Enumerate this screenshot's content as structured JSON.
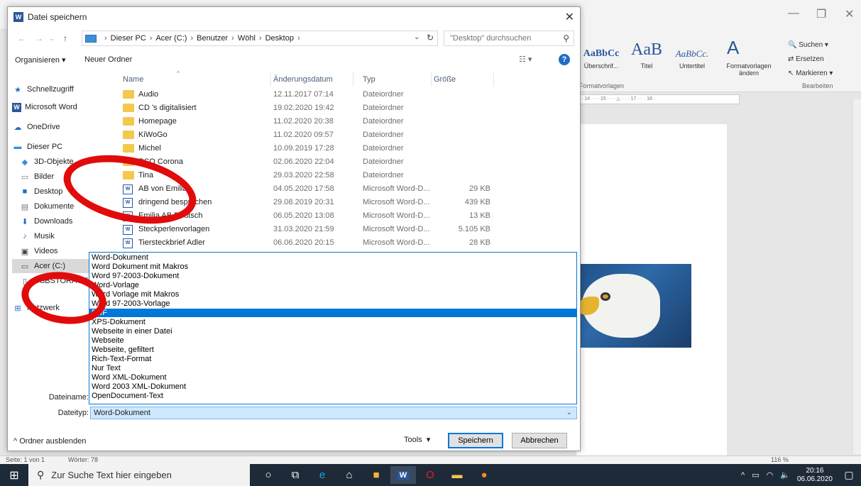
{
  "word": {
    "window_controls": [
      "—",
      "❐",
      "✕"
    ],
    "styles": [
      {
        "sample": "AaBbCc",
        "name": "Überschrif..."
      },
      {
        "sample": "AaB",
        "name": "Titel"
      },
      {
        "sample": "AaBbCc.",
        "name": "Untertitel"
      }
    ],
    "formatvorlagen_label": "Formatvorlagen",
    "formatvorlagen_aendern": "Formatvorlagen ändern",
    "bearbeiten_label": "Bearbeiten",
    "suchen": "Suchen",
    "ersetzen": "Ersetzen",
    "markieren": "Markieren",
    "ruler_text": "· 14 · · · 15 · · · △ · · · 17 · · · 18 ·",
    "status_page": "Seite: 1 von 1",
    "status_words": "Wörter: 78",
    "status_zoom": "116 %"
  },
  "dialog": {
    "title": "Datei speichern",
    "address": [
      "Dieser PC",
      "Acer (C:)",
      "Benutzer",
      "Wöhl",
      "Desktop"
    ],
    "search_placeholder": "\"Desktop\" durchsuchen",
    "organize_label": "Organisieren ▾",
    "new_folder_label": "Neuer Ordner",
    "nav": [
      {
        "label": "Schnellzugriff",
        "icon": "star-icon"
      },
      {
        "label": "Microsoft Word",
        "icon": "word-icon"
      },
      {
        "label": "OneDrive",
        "icon": "cloud-icon"
      },
      {
        "label": "Dieser PC",
        "icon": "computer-icon"
      },
      {
        "label": "3D-Objekte",
        "icon": "cube-icon"
      },
      {
        "label": "Bilder",
        "icon": "pictures-icon"
      },
      {
        "label": "Desktop",
        "icon": "desktop-icon"
      },
      {
        "label": "Dokumente",
        "icon": "documents-icon"
      },
      {
        "label": "Downloads",
        "icon": "download-icon"
      },
      {
        "label": "Musik",
        "icon": "music-icon"
      },
      {
        "label": "Videos",
        "icon": "video-icon"
      },
      {
        "label": "Acer (C:)",
        "icon": "drive-icon"
      },
      {
        "label": "USBSTORAGE",
        "icon": "usb-icon"
      },
      {
        "label": "Netzwerk",
        "icon": "network-icon"
      }
    ],
    "columns": {
      "name": "Name",
      "date": "Änderungsdatum",
      "type": "Typ",
      "size": "Größe"
    },
    "files": [
      {
        "name": "Audio",
        "date": "12.11.2017 07:14",
        "type": "Dateiordner",
        "size": "",
        "kind": "folder"
      },
      {
        "name": "CD 's digitalisiert",
        "date": "19.02.2020 19:42",
        "type": "Dateiordner",
        "size": "",
        "kind": "folder"
      },
      {
        "name": "Homepage",
        "date": "11.02.2020 20:38",
        "type": "Dateiordner",
        "size": "",
        "kind": "folder"
      },
      {
        "name": "KiWoGo",
        "date": "11.02.2020 09:57",
        "type": "Dateiordner",
        "size": "",
        "kind": "folder"
      },
      {
        "name": "Michel",
        "date": "10.09.2019 17:28",
        "type": "Dateiordner",
        "size": "",
        "kind": "folder"
      },
      {
        "name": "RSO Corona",
        "date": "02.06.2020 22:04",
        "type": "Dateiordner",
        "size": "",
        "kind": "folder"
      },
      {
        "name": "Tina",
        "date": "29.03.2020 22:58",
        "type": "Dateiordner",
        "size": "",
        "kind": "folder"
      },
      {
        "name": "AB von Emilia",
        "date": "04.05.2020 17:58",
        "type": "Microsoft Word-D...",
        "size": "29 KB",
        "kind": "doc"
      },
      {
        "name": "dringend besprochen",
        "date": "29.08.2019 20:31",
        "type": "Microsoft Word-D...",
        "size": "439 KB",
        "kind": "doc"
      },
      {
        "name": "Emilia AB Deutsch",
        "date": "06.05.2020 13:08",
        "type": "Microsoft Word-D...",
        "size": "13 KB",
        "kind": "doc"
      },
      {
        "name": "Steckperlenvorlagen",
        "date": "31.03.2020 21:59",
        "type": "Microsoft Word-D...",
        "size": "5.105 KB",
        "kind": "doc"
      },
      {
        "name": "Tiersteckbrief Adler",
        "date": "06.06.2020 20:15",
        "type": "Microsoft Word-D...",
        "size": "28 KB",
        "kind": "doc"
      }
    ],
    "type_options": [
      "Word-Dokument",
      "Word Dokument mit Makros",
      "Word 97-2003-Dokument",
      "Word-Vorlage",
      "Word Vorlage mit Makros",
      "Word 97-2003-Vorlage",
      "PDF",
      "XPS-Dokument",
      "Webseite in einer Datei",
      "Webseite",
      "Webseite, gefiltert",
      "Rich-Text-Format",
      "Nur Text",
      "Word XML-Dokument",
      "Word 2003 XML-Dokument",
      "OpenDocument-Text"
    ],
    "highlighted_index": 6,
    "filename_label": "Dateiname:",
    "filetype_label": "Dateityp:",
    "filetype_value": "Word-Dokument",
    "hide_folders_label": "Ordner ausblenden",
    "tools_label": "Tools",
    "save_label": "Speichern",
    "cancel_label": "Abbrechen"
  },
  "taskbar": {
    "search_placeholder": "Zur Suche Text hier eingeben",
    "time": "20:16",
    "date": "06.06.2020"
  },
  "colors": {
    "accent": "#0078d7",
    "annotation_red": "#e10b0b",
    "word_blue": "#2b579a"
  }
}
